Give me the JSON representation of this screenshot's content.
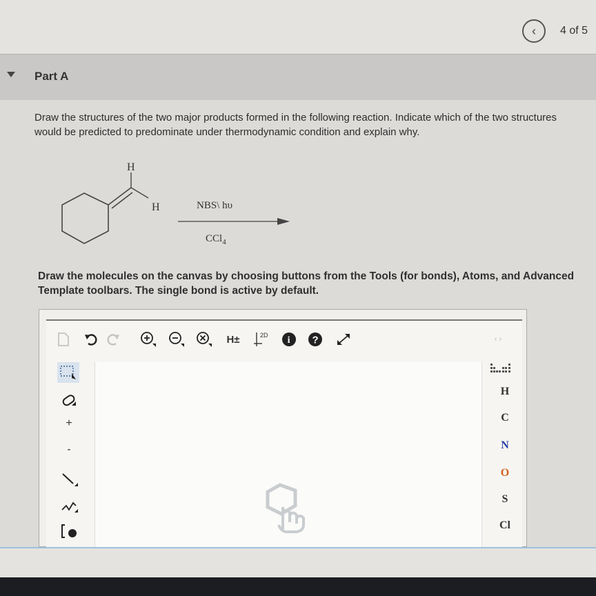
{
  "nav": {
    "page_count": "4 of 5",
    "back_icon": "chevron-left-icon"
  },
  "part": {
    "title": "Part A"
  },
  "question": {
    "text": "Draw the structures of the two major products formed in the following reaction. Indicate which of the two structures would be predicted to predominate under thermodynamic condition and explain why."
  },
  "reaction": {
    "atom_label_top": "H",
    "atom_label_right": "H",
    "reagent_above": "NBS\\ hυ",
    "reagent_below": "CCl",
    "reagent_below_subscript": "4"
  },
  "instruction": {
    "text": "Draw the molecules on the canvas by choosing buttons from the Tools (for bonds), Atoms, and Advanced Template toolbars. The single bond is active by default."
  },
  "toolbar": {
    "h_toggle": "H±",
    "two_d": "2D",
    "info": "i",
    "help": "?"
  },
  "side_tools": {
    "plus": "+",
    "minus": "-"
  },
  "atoms": [
    "H",
    "C",
    "N",
    "O",
    "S",
    "Cl"
  ],
  "colors": {
    "oxygen": "#d2611f",
    "nitrogen": "#2b3fa8",
    "editor_border": "#777777",
    "bottom_accent": "#9ec1dd"
  }
}
